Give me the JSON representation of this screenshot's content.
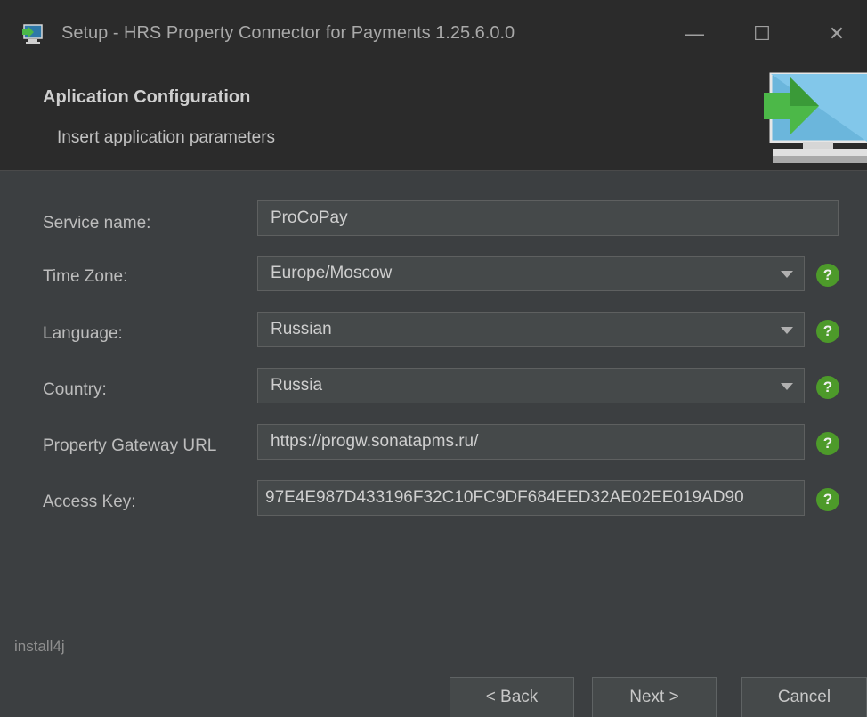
{
  "window": {
    "title": "Setup - HRS Property Connector for Payments 1.25.6.0.0",
    "minimize_glyph": "—",
    "maximize_glyph": "☐",
    "close_glyph": "✕",
    "app_icon": "installer-icon"
  },
  "header": {
    "title": "Aplication Configuration",
    "subtitle": "Insert application parameters",
    "art_icon": "monitor-install-arrow-icon"
  },
  "form": {
    "service_name": {
      "label": "Service name:",
      "value": "ProCoPay"
    },
    "time_zone": {
      "label": "Time Zone:",
      "value": "Europe/Moscow"
    },
    "language": {
      "label": "Language:",
      "value": "Russian"
    },
    "country": {
      "label": "Country:",
      "value": "Russia"
    },
    "gateway_url": {
      "label": "Property Gateway URL",
      "value": "https://progw.sonatapms.ru/"
    },
    "access_key": {
      "label": "Access Key:",
      "value": "97E4E987D433196F32C10FC9DF684EED32AE02EE019AD90"
    },
    "help_glyph": "?"
  },
  "footer": {
    "brand": "install4j",
    "back_label": "< Back",
    "next_label": "Next >",
    "cancel_label": "Cancel"
  },
  "colors": {
    "background": "#3c3f41",
    "header_background": "#2b2b2b",
    "field_background": "#45494a",
    "help_green": "#4d9a2a"
  }
}
